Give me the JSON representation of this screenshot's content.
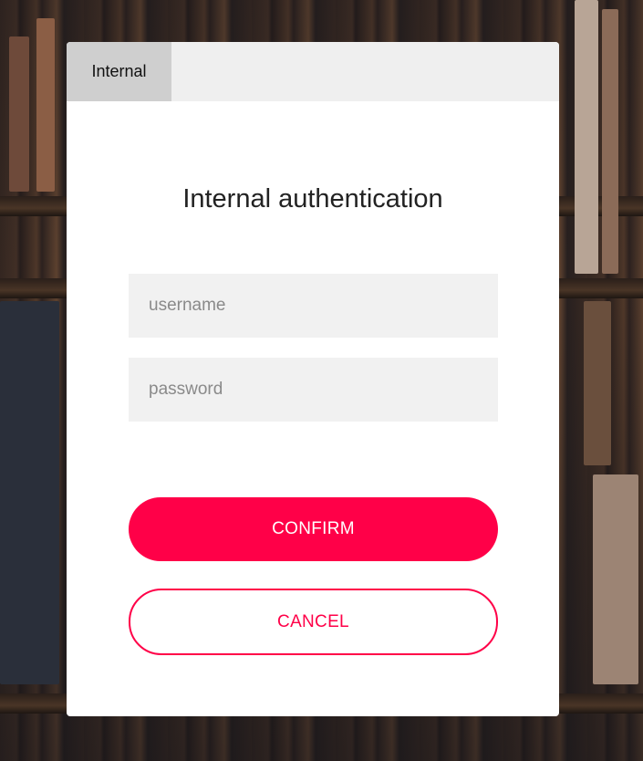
{
  "tabs": [
    {
      "label": "Internal",
      "active": true
    }
  ],
  "dialog": {
    "title": "Internal authentication"
  },
  "form": {
    "username_placeholder": "username",
    "username_value": "",
    "password_placeholder": "password",
    "password_value": ""
  },
  "actions": {
    "confirm_label": "CONFIRM",
    "cancel_label": "CANCEL"
  },
  "colors": {
    "accent": "#ff0048",
    "tab_active": "#cfcfcf",
    "tabbar": "#efefef",
    "field_bg": "#f1f1f1"
  }
}
